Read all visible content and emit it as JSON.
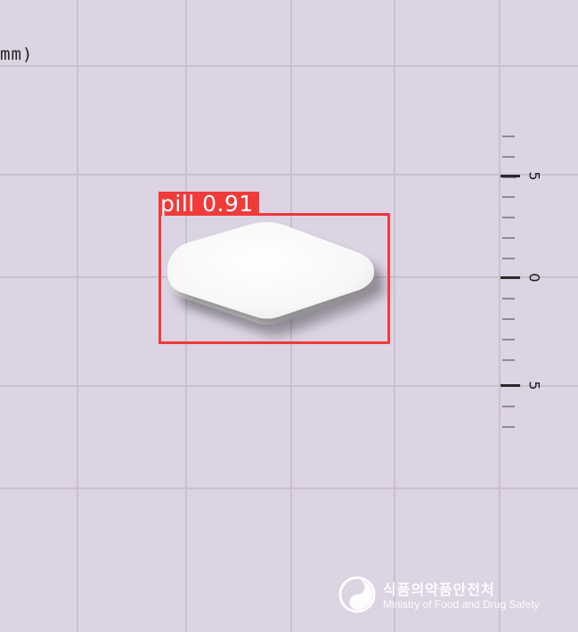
{
  "unit_label": "mm)",
  "ruler": {
    "labels": [
      "5",
      "0",
      "5"
    ]
  },
  "detection": {
    "label": "pill 0.91",
    "class_name": "pill",
    "confidence": 0.91,
    "color": "#f03b3b"
  },
  "watermark": {
    "korean": "식품의약품안전처",
    "english": "Ministry of Food and Drug Safety",
    "icon": "ministry-emblem-icon"
  },
  "colors": {
    "background": "#dcd3e3",
    "grid": "#c9bfd2",
    "pill": "#fbfbfb"
  }
}
